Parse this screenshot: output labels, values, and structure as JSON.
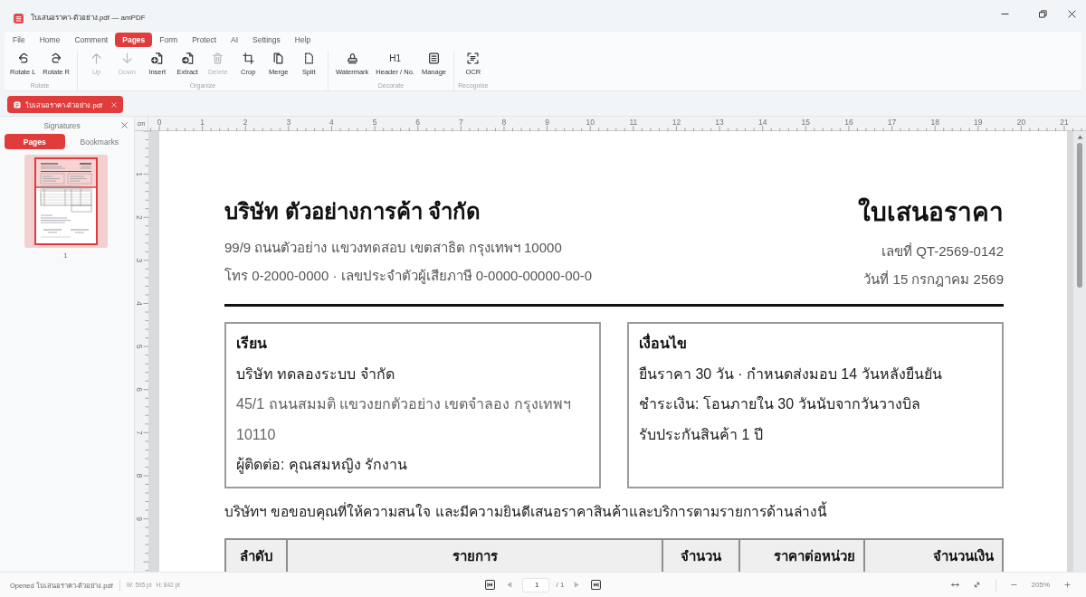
{
  "window": {
    "title": "ใบเสนอราคา-ตัวอย่าง.pdf — amPDF"
  },
  "menu": [
    {
      "label": "File",
      "selected": false
    },
    {
      "label": "Home",
      "selected": false
    },
    {
      "label": "Comment",
      "selected": false
    },
    {
      "label": "Pages",
      "selected": true
    },
    {
      "label": "Form",
      "selected": false
    },
    {
      "label": "Protect",
      "selected": false
    },
    {
      "label": "AI",
      "selected": false
    },
    {
      "label": "Settings",
      "selected": false
    },
    {
      "label": "Help",
      "selected": false
    }
  ],
  "ribbon": {
    "groups": [
      {
        "label": "Rotate",
        "buttons": [
          {
            "label": "Rotate L",
            "disabled": false
          },
          {
            "label": "Rotate R",
            "disabled": false
          }
        ]
      },
      {
        "label": "Organize",
        "buttons": [
          {
            "label": "Up",
            "disabled": true
          },
          {
            "label": "Down",
            "disabled": true
          },
          {
            "label": "Insert",
            "disabled": false
          },
          {
            "label": "Extract",
            "disabled": false
          },
          {
            "label": "Delete",
            "disabled": true
          },
          {
            "label": "Crop",
            "disabled": false
          },
          {
            "label": "Merge",
            "disabled": false
          },
          {
            "label": "Split",
            "disabled": false
          }
        ]
      },
      {
        "label": "Decorate",
        "buttons": [
          {
            "label": "Watermark",
            "disabled": false
          },
          {
            "label": "Header / No.",
            "glyph": "H1",
            "disabled": false
          },
          {
            "label": "Manage",
            "disabled": false
          }
        ]
      },
      {
        "label": "Recognise",
        "buttons": [
          {
            "label": "OCR",
            "disabled": false
          }
        ]
      }
    ]
  },
  "document_tabs": [
    {
      "label": "ใบเสนอราคา-ตัวอย่าง.pdf",
      "selected": true
    }
  ],
  "side_panel": {
    "tabs": [
      {
        "label": "Signatures",
        "selected": false
      },
      {
        "label": "Pages",
        "selected": true
      },
      {
        "label": "Bookmarks",
        "selected": false
      }
    ],
    "thumbnails": [
      {
        "label": "1",
        "selected": true
      }
    ]
  },
  "ruler": {
    "unit": "cm",
    "top_labels": [
      "0",
      "1",
      "2",
      "3",
      "4",
      "5",
      "6",
      "7",
      "8",
      "9",
      "10",
      "11",
      "12",
      "13",
      "14",
      "15",
      "16",
      "17",
      "18",
      "19",
      "20",
      "21"
    ],
    "side_labels": [
      "1",
      "2",
      "3",
      "4",
      "5",
      "6",
      "7",
      "8",
      "9"
    ]
  },
  "document": {
    "company": "บริษัท ตัวอย่างการค้า จำกัด",
    "company_lines": [
      "99/9 ถนนตัวอย่าง แขวงทดสอบ เขตสาธิต กรุงเทพฯ 10000",
      "โทร 0-2000-0000 · เลขประจำตัวผู้เสียภาษี 0-0000-00000-00-0"
    ],
    "title": "ใบเสนอราคา",
    "title_lines": [
      "เลขที่ QT-2569-0142",
      "วันที่ 15 กรกฎาคม 2569"
    ],
    "boxes": [
      {
        "heading": "เรียน",
        "lines": [
          {
            "text": "บริษัท ทดลองระบบ จำกัด",
            "muted": false
          },
          {
            "text": "45/1 ถนนสมมติ แขวงยกตัวอย่าง เขตจำลอง กรุงเทพฯ 10110",
            "muted": true
          },
          {
            "text": "ผู้ติดต่อ: คุณสมหญิง รักงาน",
            "muted": false
          }
        ]
      },
      {
        "heading": "เงื่อนไข",
        "lines": [
          {
            "text": "ยืนราคา 30 วัน · กำหนดส่งมอบ 14 วันหลังยืนยัน",
            "muted": false
          },
          {
            "text": "ชำระเงิน: โอนภายใน 30 วันนับจากวันวางบิล",
            "muted": false
          },
          {
            "text": "รับประกันสินค้า 1 ปี",
            "muted": false
          }
        ]
      }
    ],
    "intro": "บริษัทฯ ขอขอบคุณที่ให้ความสนใจ และมีความยินดีเสนอราคาสินค้าและบริการตามรายการด้านล่างนี้",
    "table": {
      "columns": [
        "ลำดับ",
        "รายการ",
        "จำนวน",
        "ราคาต่อหน่วย",
        "จำนวนเงิน"
      ]
    }
  },
  "status_bar": {
    "message": "Opened ใบเสนอราคา-ตัวอย่าง.pdf",
    "page_width": "W: 595 pt",
    "page_height": "H: 842 pt",
    "navigation": [
      {
        "kind": "first",
        "disabled": false
      },
      {
        "kind": "previous",
        "disabled": true
      },
      {
        "kind": "next",
        "disabled": true
      },
      {
        "kind": "last",
        "disabled": false
      }
    ],
    "page": "1",
    "page_total": "/ 1",
    "zoom": "205%"
  }
}
